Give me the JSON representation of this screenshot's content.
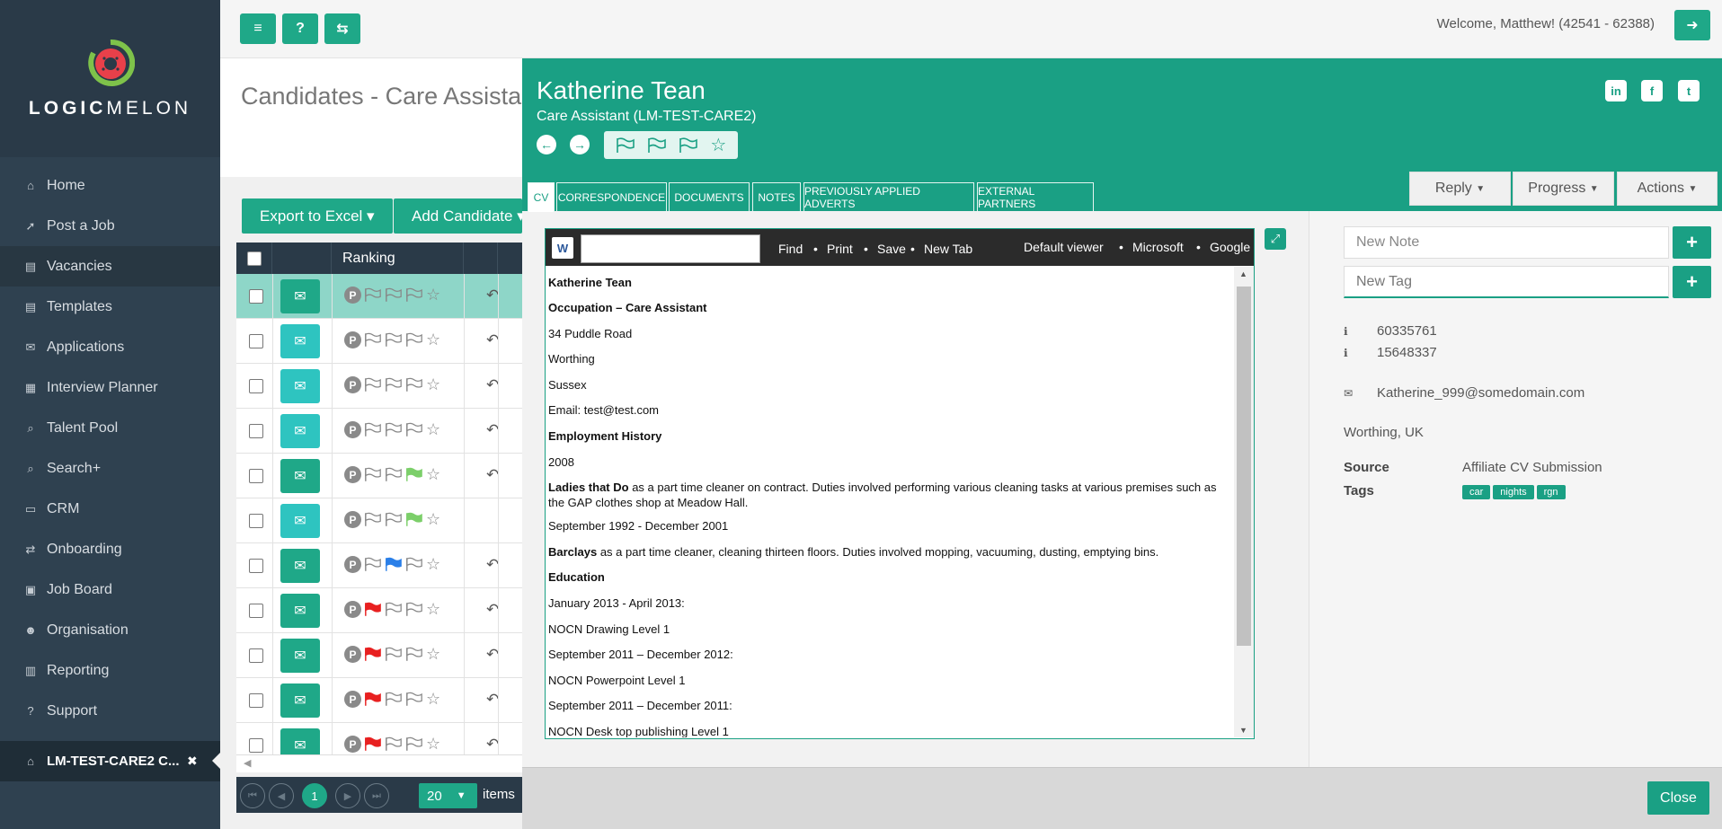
{
  "brand": {
    "logo_bold": "LOGIC",
    "logo_light": "MELON"
  },
  "colors": {
    "accent": "#1aa084",
    "sidebar": "#2f4150",
    "flag_red": "#e82020",
    "flag_green": "#7ccf6a",
    "flag_blue": "#2a7fe8"
  },
  "sidebar": {
    "items": [
      {
        "label": "Home",
        "icon": "home-icon",
        "glyph": "⌂"
      },
      {
        "label": "Post a Job",
        "icon": "rocket-icon",
        "glyph": "➚"
      },
      {
        "label": "Vacancies",
        "icon": "newspaper-icon",
        "glyph": "▤"
      },
      {
        "label": "Templates",
        "icon": "newspaper-icon",
        "glyph": "▤"
      },
      {
        "label": "Applications",
        "icon": "envelope-icon",
        "glyph": "✉"
      },
      {
        "label": "Interview Planner",
        "icon": "calendar-icon",
        "glyph": "▦"
      },
      {
        "label": "Talent Pool",
        "icon": "search-icon",
        "glyph": "⌕"
      },
      {
        "label": "Search+",
        "icon": "search-plus-icon",
        "glyph": "⌕"
      },
      {
        "label": "CRM",
        "icon": "window-icon",
        "glyph": "▭"
      },
      {
        "label": "Onboarding",
        "icon": "exchange-icon",
        "glyph": "⇄"
      },
      {
        "label": "Job Board",
        "icon": "briefcase-icon",
        "glyph": "▣"
      },
      {
        "label": "Organisation",
        "icon": "users-icon",
        "glyph": "☻"
      },
      {
        "label": "Reporting",
        "icon": "chart-icon",
        "glyph": "▥"
      },
      {
        "label": "Support",
        "icon": "question-icon",
        "glyph": "?"
      }
    ],
    "current_tab": "LM-TEST-CARE2 C...",
    "current_close": "✖"
  },
  "topbar": {
    "welcome": "Welcome, Matthew! (42541 - 62388)"
  },
  "page": {
    "title": "Candidates - Care Assistant"
  },
  "grid": {
    "export_label": "Export to Excel",
    "add_label": "Add Candidate",
    "ranking_header": "Ranking",
    "rows": [
      {
        "env": "open",
        "flags": [
          "empty",
          "empty",
          "empty"
        ],
        "reply": true
      },
      {
        "env": "closed",
        "flags": [
          "empty",
          "empty",
          "empty"
        ],
        "reply": true
      },
      {
        "env": "closed",
        "flags": [
          "empty",
          "empty",
          "empty"
        ],
        "reply": true
      },
      {
        "env": "closed",
        "flags": [
          "empty",
          "empty",
          "empty"
        ],
        "reply": true
      },
      {
        "env": "open",
        "flags": [
          "empty",
          "empty",
          "green"
        ],
        "reply": true
      },
      {
        "env": "closed",
        "flags": [
          "empty",
          "empty",
          "green"
        ],
        "reply": false
      },
      {
        "env": "open",
        "flags": [
          "empty",
          "blue",
          "empty"
        ],
        "reply": true
      },
      {
        "env": "open",
        "flags": [
          "red",
          "empty",
          "empty"
        ],
        "reply": true
      },
      {
        "env": "open",
        "flags": [
          "red",
          "empty",
          "empty"
        ],
        "reply": true
      },
      {
        "env": "open",
        "flags": [
          "red",
          "empty",
          "empty"
        ],
        "reply": true
      },
      {
        "env": "open",
        "flags": [
          "red",
          "empty",
          "empty"
        ],
        "reply": true
      }
    ],
    "pager": {
      "current": "1",
      "page_size": "20",
      "items_label": "items"
    }
  },
  "panel": {
    "name": "Katherine Tean",
    "subtitle": "Care Assistant (LM-TEST-CARE2)",
    "tabs": [
      "CV",
      "CORRESPONDENCE",
      "DOCUMENTS",
      "NOTES",
      "PREVIOUSLY APPLIED ADVERTS",
      "EXTERNAL PARTNERS"
    ],
    "reply_label": "Reply",
    "progress_label": "Progress",
    "actions_label": "Actions",
    "viewer": {
      "find": "Find",
      "print": "Print",
      "save": "Save",
      "new_tab": "New Tab",
      "default_viewer": "Default viewer",
      "microsoft": "Microsoft",
      "google": "Google"
    },
    "cv": {
      "name": "Katherine Tean",
      "occupation": "Occupation – Care Assistant",
      "address1": "34 Puddle Road",
      "address2": "Worthing",
      "address3": "Sussex",
      "email": "Email: test@test.com",
      "employment_heading": "Employment History",
      "year": "2008",
      "job1_company": "Ladies that Do",
      "job1_desc": " as a part time cleaner on contract. Duties involved performing various cleaning tasks at various premises such as the GAP clothes shop at Meadow Hall.",
      "job2_dates": "September 1992 - December 2001",
      "job2_company": "Barclays",
      "job2_desc": " as a part time cleaner, cleaning thirteen floors. Duties involved mopping, vacuuming, dusting, emptying bins.",
      "education_heading": "Education",
      "edu1_dates": "January 2013 - April 2013:",
      "edu1": "NOCN Drawing Level 1",
      "edu2_dates": "September 2011 – December 2012:",
      "edu2": "NOCN Powerpoint Level 1",
      "edu3_dates": "September 2011 – December 2011:",
      "edu3": "NOCN Desk top publishing Level 1"
    },
    "side": {
      "note_placeholder": "New Note",
      "tag_placeholder": "New Tag",
      "id1": "60335761",
      "id2": "15648337",
      "email": "Katherine_999@somedomain.com",
      "location": "Worthing, UK",
      "source_label": "Source",
      "source_value": "Affiliate CV Submission",
      "tags_label": "Tags",
      "tags": [
        "car",
        "nights",
        "rgn"
      ]
    },
    "close_label": "Close"
  }
}
